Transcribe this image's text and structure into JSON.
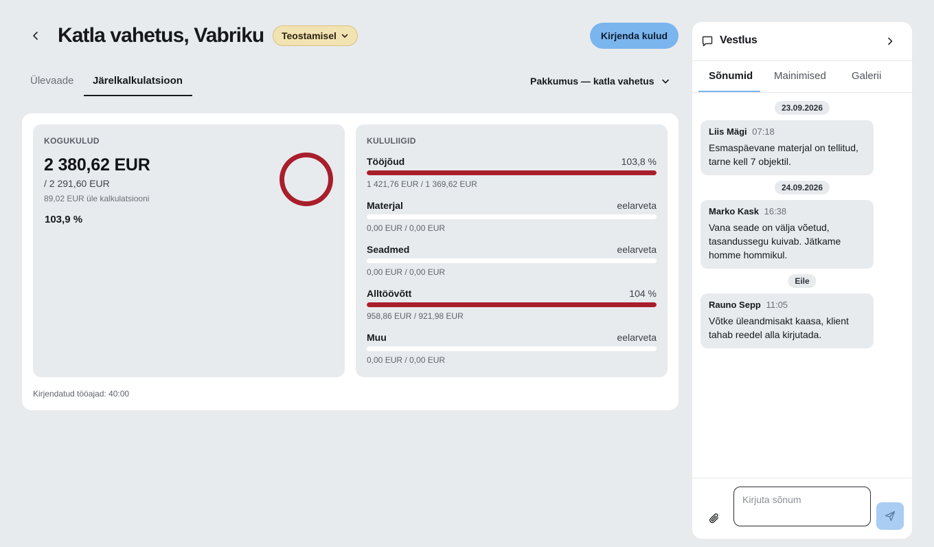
{
  "header": {
    "title": "Katla vahetus, Vabriku",
    "status": "Teostamisel",
    "primary_action": "Kirjenda kulud"
  },
  "tabs": [
    {
      "label": "Ülevaade",
      "active": false
    },
    {
      "label": "Järelkalkulatsioon",
      "active": true
    }
  ],
  "offer_select": {
    "value": "Pakkumus — katla vahetus"
  },
  "total": {
    "label": "KOGUKULUD",
    "amount": "2 380,62 EUR",
    "budget": "/ 2 291,60 EUR",
    "over_text": "89,02 EUR üle kalkulatsiooni",
    "percent_text": "103,9 %",
    "percent_value": 103.9,
    "donut_color": "#a81e2b"
  },
  "cost_types": {
    "label": "KULULIIGID",
    "items": [
      {
        "name": "Tööjõud",
        "status": "103,8 %",
        "amounts": "1 421,76 EUR / 1 369,62 EUR",
        "fill": 1.0
      },
      {
        "name": "Materjal",
        "status": "eelarveta",
        "amounts": "0,00 EUR / 0,00 EUR",
        "fill": 0
      },
      {
        "name": "Seadmed",
        "status": "eelarveta",
        "amounts": "0,00 EUR / 0,00 EUR",
        "fill": 0
      },
      {
        "name": "Alltöövõtt",
        "status": "104 %",
        "amounts": "958,86 EUR / 921,98 EUR",
        "fill": 1.0
      },
      {
        "name": "Muu",
        "status": "eelarveta",
        "amounts": "0,00 EUR / 0,00 EUR",
        "fill": 0
      }
    ]
  },
  "hours_line": "Kirjendatud tööajad: 40:00",
  "chat": {
    "title": "Vestlus",
    "tabs": [
      {
        "label": "Sõnumid",
        "active": true
      },
      {
        "label": "Mainimised",
        "active": false
      },
      {
        "label": "Galerii",
        "active": false
      }
    ],
    "groups": [
      {
        "date": "23.09.2026",
        "messages": [
          {
            "author": "Liis Mägi",
            "time": "07:18",
            "text": "Esmaspäevane materjal on tellitud, tarne kell 7 objektil."
          }
        ]
      },
      {
        "date": "24.09.2026",
        "messages": [
          {
            "author": "Marko Kask",
            "time": "16:38",
            "text": "Vana seade on välja võetud, tasandussegu kuivab. Jätkame homme hommikul."
          }
        ]
      },
      {
        "date": "Eile",
        "messages": [
          {
            "author": "Rauno Sepp",
            "time": "11:05",
            "text": "Võtke üleandmisakt kaasa, klient tahab reedel alla kirjutada."
          }
        ]
      }
    ],
    "input_placeholder": "Kirjuta sõnum"
  },
  "icons": {
    "back": "chevron-left-icon",
    "status_dropdown": "chevron-down-icon",
    "offer_dropdown": "chevron-down-icon",
    "chat": "chat-bubble-icon",
    "chat_close": "chevron-right-icon",
    "attach": "paperclip-icon",
    "send": "send-icon"
  }
}
